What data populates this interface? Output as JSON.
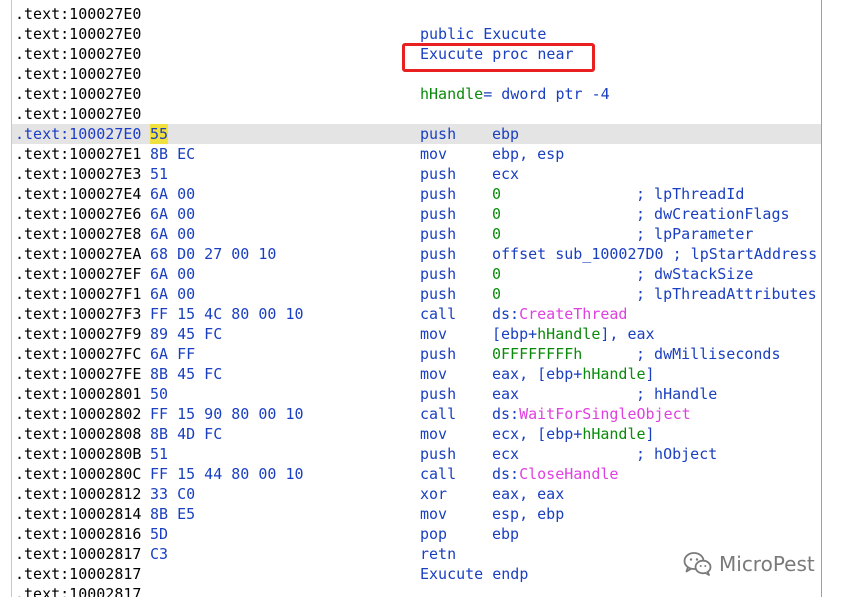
{
  "listing": {
    "rows": [
      {
        "addr": ".text:100027E0",
        "bytes": "",
        "mnem": "",
        "ops": [],
        "cmt": ""
      },
      {
        "addr": ".text:100027E0",
        "bytes": "",
        "mnem": "public Exucute",
        "ops": [],
        "cmt": ""
      },
      {
        "addr": ".text:100027E0",
        "bytes": "",
        "mnem": "Exucute proc near",
        "ops": [],
        "cmt": ""
      },
      {
        "addr": ".text:100027E0",
        "bytes": "",
        "mnem": "",
        "ops": [],
        "cmt": ""
      },
      {
        "addr": ".text:100027E0",
        "bytes": "",
        "mnem": "",
        "ops": [],
        "cmt": "",
        "full": [
          {
            "t": "hHandle",
            "c": "var"
          },
          {
            "t": "= dword ptr -4",
            "c": "plain"
          }
        ]
      },
      {
        "addr": ".text:100027E0",
        "bytes": "",
        "mnem": "",
        "ops": [],
        "cmt": ""
      },
      {
        "addr": ".text:100027E0",
        "bytes": "55",
        "mnem": "push",
        "ops": [
          {
            "t": "ebp",
            "c": "plain"
          }
        ],
        "cmt": "",
        "selected": true
      },
      {
        "addr": ".text:100027E1",
        "bytes": "8B EC",
        "mnem": "mov",
        "ops": [
          {
            "t": "ebp, esp",
            "c": "plain"
          }
        ],
        "cmt": ""
      },
      {
        "addr": ".text:100027E3",
        "bytes": "51",
        "mnem": "push",
        "ops": [
          {
            "t": "ecx",
            "c": "plain"
          }
        ],
        "cmt": ""
      },
      {
        "addr": ".text:100027E4",
        "bytes": "6A 00",
        "mnem": "push",
        "ops": [
          {
            "t": "0",
            "c": "num"
          }
        ],
        "cmt": "; lpThreadId"
      },
      {
        "addr": ".text:100027E6",
        "bytes": "6A 00",
        "mnem": "push",
        "ops": [
          {
            "t": "0",
            "c": "num"
          }
        ],
        "cmt": "; dwCreationFlags"
      },
      {
        "addr": ".text:100027E8",
        "bytes": "6A 00",
        "mnem": "push",
        "ops": [
          {
            "t": "0",
            "c": "num"
          }
        ],
        "cmt": "; lpParameter"
      },
      {
        "addr": ".text:100027EA",
        "bytes": "68 D0 27 00 10",
        "mnem": "push",
        "ops": [
          {
            "t": "offset sub_100027D0 ; lpStartAddress",
            "c": "plain"
          }
        ],
        "cmt": ""
      },
      {
        "addr": ".text:100027EF",
        "bytes": "6A 00",
        "mnem": "push",
        "ops": [
          {
            "t": "0",
            "c": "num"
          }
        ],
        "cmt": "; dwStackSize"
      },
      {
        "addr": ".text:100027F1",
        "bytes": "6A 00",
        "mnem": "push",
        "ops": [
          {
            "t": "0",
            "c": "num"
          }
        ],
        "cmt": "; lpThreadAttributes"
      },
      {
        "addr": ".text:100027F3",
        "bytes": "FF 15 4C 80 00 10",
        "mnem": "call",
        "ops": [
          {
            "t": "ds:",
            "c": "plain"
          },
          {
            "t": "CreateThread",
            "c": "api"
          }
        ],
        "cmt": ""
      },
      {
        "addr": ".text:100027F9",
        "bytes": "89 45 FC",
        "mnem": "mov",
        "ops": [
          {
            "t": "[ebp+",
            "c": "plain"
          },
          {
            "t": "hHandle",
            "c": "var"
          },
          {
            "t": "], eax",
            "c": "plain"
          }
        ],
        "cmt": ""
      },
      {
        "addr": ".text:100027FC",
        "bytes": "6A FF",
        "mnem": "push",
        "ops": [
          {
            "t": "0FFFFFFFFh",
            "c": "num"
          }
        ],
        "cmt": "; dwMilliseconds"
      },
      {
        "addr": ".text:100027FE",
        "bytes": "8B 45 FC",
        "mnem": "mov",
        "ops": [
          {
            "t": "eax, [ebp+",
            "c": "plain"
          },
          {
            "t": "hHandle",
            "c": "var"
          },
          {
            "t": "]",
            "c": "plain"
          }
        ],
        "cmt": ""
      },
      {
        "addr": ".text:10002801",
        "bytes": "50",
        "mnem": "push",
        "ops": [
          {
            "t": "eax",
            "c": "plain"
          }
        ],
        "cmt": "; hHandle"
      },
      {
        "addr": ".text:10002802",
        "bytes": "FF 15 90 80 00 10",
        "mnem": "call",
        "ops": [
          {
            "t": "ds:",
            "c": "plain"
          },
          {
            "t": "WaitForSingleObject",
            "c": "api"
          }
        ],
        "cmt": ""
      },
      {
        "addr": ".text:10002808",
        "bytes": "8B 4D FC",
        "mnem": "mov",
        "ops": [
          {
            "t": "ecx, [ebp+",
            "c": "plain"
          },
          {
            "t": "hHandle",
            "c": "var"
          },
          {
            "t": "]",
            "c": "plain"
          }
        ],
        "cmt": ""
      },
      {
        "addr": ".text:1000280B",
        "bytes": "51",
        "mnem": "push",
        "ops": [
          {
            "t": "ecx",
            "c": "plain"
          }
        ],
        "cmt": "; hObject"
      },
      {
        "addr": ".text:1000280C",
        "bytes": "FF 15 44 80 00 10",
        "mnem": "call",
        "ops": [
          {
            "t": "ds:",
            "c": "plain"
          },
          {
            "t": "CloseHandle",
            "c": "api"
          }
        ],
        "cmt": ""
      },
      {
        "addr": ".text:10002812",
        "bytes": "33 C0",
        "mnem": "xor",
        "ops": [
          {
            "t": "eax, eax",
            "c": "plain"
          }
        ],
        "cmt": ""
      },
      {
        "addr": ".text:10002814",
        "bytes": "8B E5",
        "mnem": "mov",
        "ops": [
          {
            "t": "esp, ebp",
            "c": "plain"
          }
        ],
        "cmt": ""
      },
      {
        "addr": ".text:10002816",
        "bytes": "5D",
        "mnem": "pop",
        "ops": [
          {
            "t": "ebp",
            "c": "plain"
          }
        ],
        "cmt": ""
      },
      {
        "addr": ".text:10002817",
        "bytes": "C3",
        "mnem": "retn",
        "ops": [],
        "cmt": ""
      },
      {
        "addr": ".text:10002817",
        "bytes": "",
        "mnem": "Exucute endp",
        "ops": [],
        "cmt": ""
      },
      {
        "addr": ".text:10002817",
        "bytes": "",
        "mnem": "",
        "ops": [],
        "cmt": ""
      }
    ]
  },
  "watermark": {
    "text": "MicroPest",
    "icon": "wechat-icon"
  },
  "colors": {
    "code_blue": "#1a3fc0",
    "variable_green": "#0a8a0a",
    "api_magenta": "#e040e0",
    "selection_gray": "#e4e4e4",
    "byte_highlight": "#f0e040",
    "annotation_red": "#e82020"
  }
}
